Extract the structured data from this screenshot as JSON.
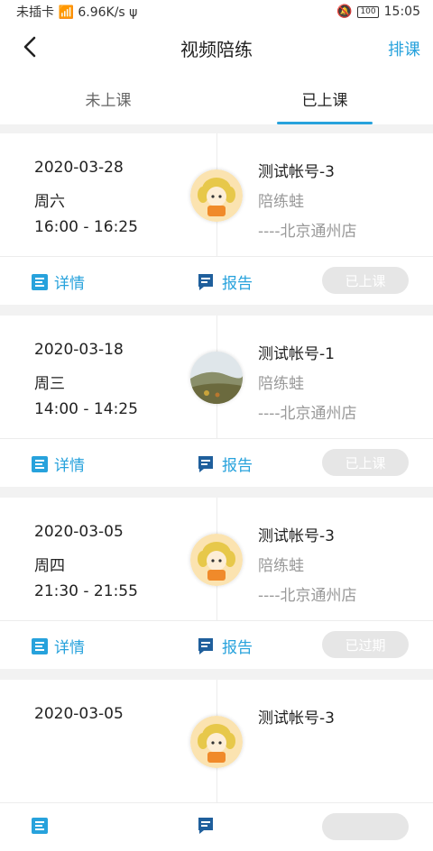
{
  "status_bar": {
    "carrier": "未插卡",
    "speed": "6.96K/s",
    "battery": "100",
    "time": "15:05"
  },
  "nav": {
    "title": "视频陪练",
    "action": "排课"
  },
  "tabs": [
    {
      "label": "未上课"
    },
    {
      "label": "已上课"
    }
  ],
  "cards": [
    {
      "date": "2020-03-28",
      "weekday": "周六",
      "time": "16:00 - 16:25",
      "account": "测试帐号-3",
      "coach": "陪练蛙",
      "store": "----北京通州店",
      "avatar": "girl",
      "detail_label": "详情",
      "report_label": "报告",
      "status_label": "已上课"
    },
    {
      "date": "2020-03-18",
      "weekday": "周三",
      "time": "14:00 - 14:25",
      "account": "测试帐号-1",
      "coach": "陪练蛙",
      "store": "----北京通州店",
      "avatar": "landscape",
      "detail_label": "详情",
      "report_label": "报告",
      "status_label": "已上课"
    },
    {
      "date": "2020-03-05",
      "weekday": "周四",
      "time": "21:30 - 21:55",
      "account": "测试帐号-3",
      "coach": "陪练蛙",
      "store": "----北京通州店",
      "avatar": "girl",
      "detail_label": "详情",
      "report_label": "报告",
      "status_label": "已过期"
    },
    {
      "date": "2020-03-05",
      "weekday": "",
      "time": "",
      "account": "测试帐号-3",
      "coach": "",
      "store": "",
      "avatar": "girl",
      "detail_label": "",
      "report_label": "",
      "status_label": ""
    }
  ],
  "colors": {
    "accent": "#27a2dc",
    "disabled_button": "#e6e6e6"
  }
}
